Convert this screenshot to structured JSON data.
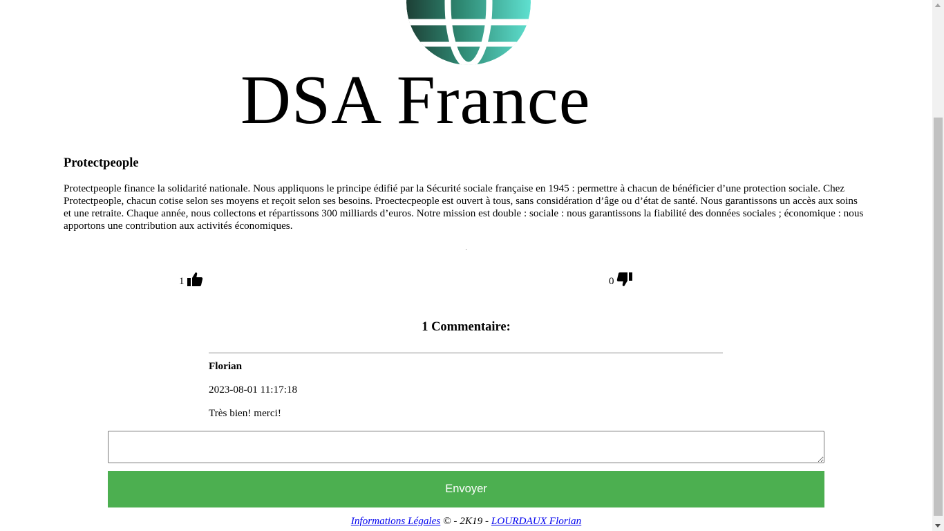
{
  "logo": {
    "text": "DSA France",
    "colors": {
      "globe_dark": "#1d3f35",
      "globe_light": "#5fe0d0"
    }
  },
  "article": {
    "title": "Protectpeople",
    "body": "Protectpeople finance la solidarité nationale. Nous appliquons le principe édifié par la Sécurité sociale française en 1945 : permettre à chacun de bénéficier d’une protection sociale. Chez Protectpeople, chacun cotise selon ses moyens et reçoit selon ses besoins. Proectecpeople est ouvert à tous, sans considération d’âge ou d’état de santé. Nous garantissons un accès aux soins et une retraite. Chaque année, nous collectons et répartissons 300 milliards d’euros. Notre mission est double : sociale : nous garantissons la fiabilité des données sociales ; économique : nous apportons une contribution aux activités économiques."
  },
  "votes": {
    "likes": "1",
    "dislikes": "0",
    "like_icon": "thumbs-up-icon",
    "dislike_icon": "thumbs-down-icon"
  },
  "comments": {
    "heading": "1 Commentaire:",
    "items": [
      {
        "author": "Florian",
        "date": "2023-08-01 11:17:18",
        "text": "Très bien! merci!"
      }
    ]
  },
  "form": {
    "input_value": "",
    "submit_label": "Envoyer",
    "submit_color": "#4caf50"
  },
  "footer": {
    "legal_link": "Informations Légales",
    "middle": " © - 2K19 - ",
    "author_link": "LOURDAUX Florian"
  }
}
